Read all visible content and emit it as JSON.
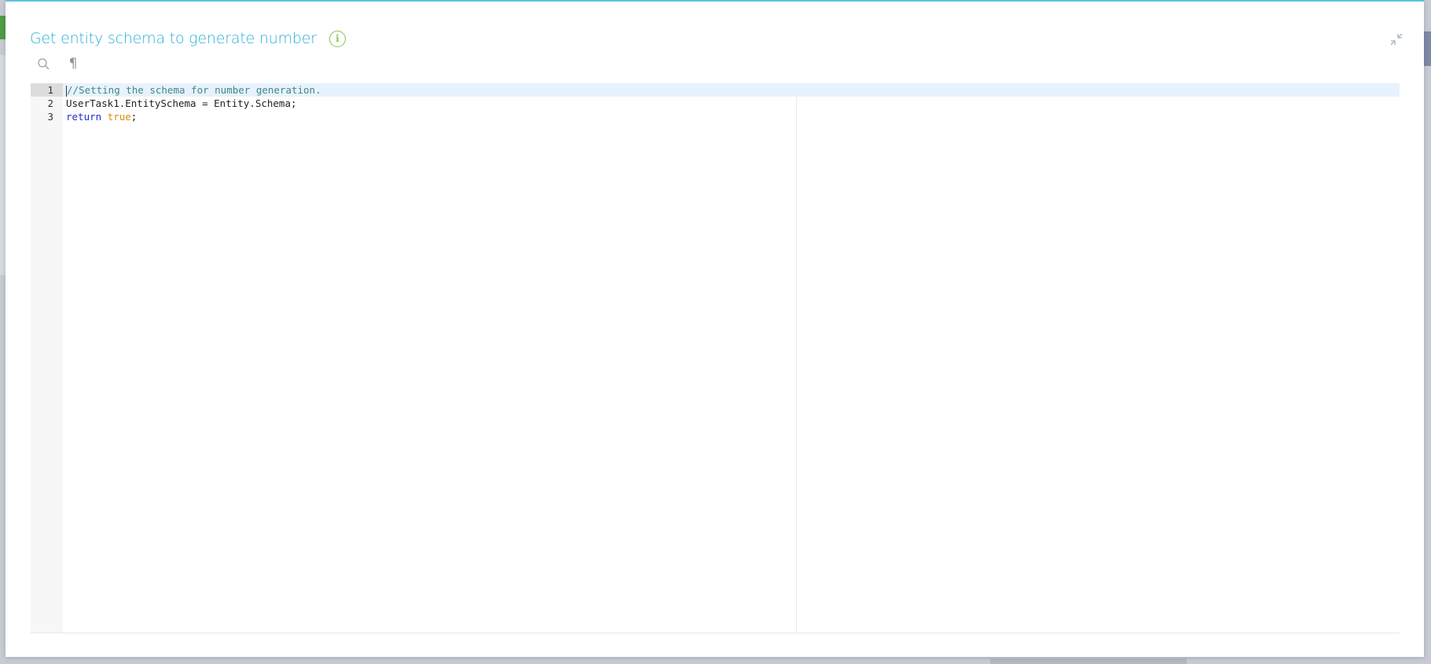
{
  "modal": {
    "title": "Get entity schema to generate number",
    "info_icon": "info-icon",
    "collapse_icon": "collapse-icon"
  },
  "toolbar": {
    "search_icon": "search-icon",
    "pilcrow_glyph": "¶"
  },
  "editor": {
    "lines": [
      {
        "number": "1",
        "comment": "//Setting the schema for number generation."
      },
      {
        "number": "2",
        "plain": "UserTask1.EntitySchema = Entity.Schema;"
      },
      {
        "number": "3",
        "keyword": "return",
        "bool": "true",
        "end": ";"
      }
    ]
  },
  "colors": {
    "accent": "#2ab0d8",
    "info": "#8cc34b",
    "comment": "#3f8a84",
    "keyword": "#1f2bd1",
    "boolean": "#d88b0a"
  }
}
